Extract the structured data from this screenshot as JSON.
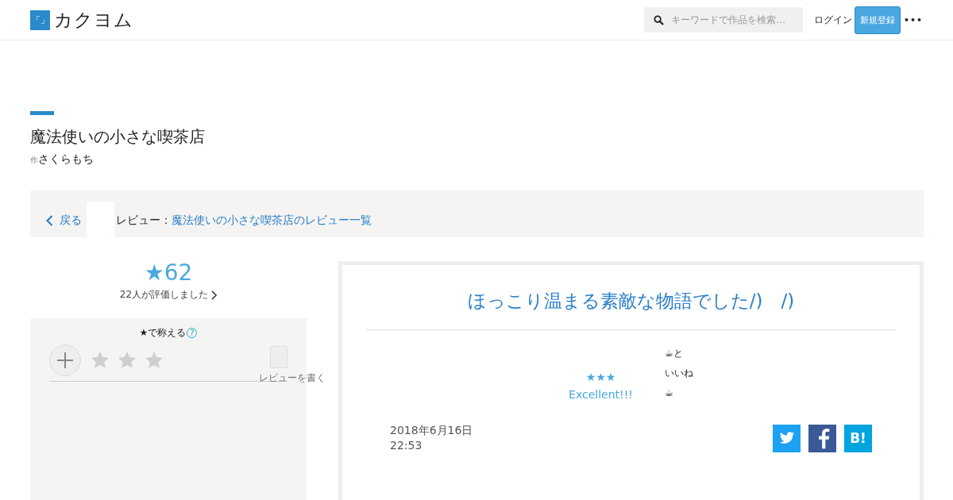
{
  "header": {
    "logo_mark": "「」",
    "logo_text": "カクヨム",
    "search": {
      "placeholder": "キーワードで作品を検索…"
    },
    "login": "ログイン",
    "signup": "新規登録",
    "more": "•••"
  },
  "work": {
    "title": "魔法使いの小さな喫茶店",
    "author_prefix": "作",
    "author": "さくらもち"
  },
  "breadcrumb": {
    "back": "戻る",
    "label": "レビュー：",
    "link": "魔法使いの小さな喫茶店のレビュー一覧"
  },
  "rating": {
    "total": "★62",
    "count": "22人が評価しました",
    "praise_title": "★で称える",
    "help": "?",
    "stars": 0,
    "write_review": "レビューを書く"
  },
  "review": {
    "title": "ほっこり温まる素敵な物語でした/)　/)",
    "stars_text": "★★★",
    "verdict": "Excellent!!!",
    "lines": [
      "☕と",
      "いいね",
      "☕"
    ],
    "date": "2018年6月16日",
    "time": "22:53",
    "share": [
      {
        "kind": "twitter"
      },
      {
        "kind": "facebook"
      },
      {
        "kind": "hatena",
        "label": "B!"
      }
    ]
  }
}
